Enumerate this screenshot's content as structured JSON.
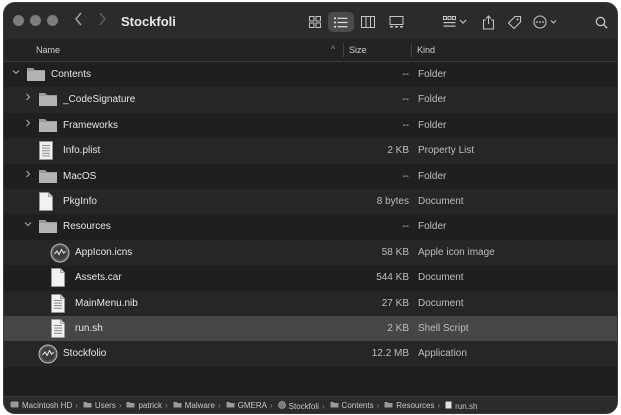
{
  "window": {
    "title": "Stockfoli"
  },
  "toolbar": {
    "back_icon": "chevron-left-icon",
    "forward_icon": "chevron-right-icon",
    "views": [
      "icon-view-icon",
      "list-view-icon",
      "column-view-icon",
      "gallery-view-icon"
    ],
    "group_icon": "group-icon",
    "share_icon": "share-icon",
    "tag_icon": "tag-icon",
    "more_icon": "more-icon",
    "search_icon": "search-icon"
  },
  "columns": {
    "name": "Name",
    "size": "Size",
    "kind": "Kind"
  },
  "rows": [
    {
      "name": "Contents",
      "size": "--",
      "kind": "Folder",
      "type": "folder",
      "disclosure": "open",
      "indent": 0
    },
    {
      "name": "_CodeSignature",
      "size": "--",
      "kind": "Folder",
      "type": "folder",
      "disclosure": "closed",
      "indent": 1
    },
    {
      "name": "Frameworks",
      "size": "--",
      "kind": "Folder",
      "type": "folder",
      "disclosure": "closed",
      "indent": 1
    },
    {
      "name": "Info.plist",
      "size": "2 KB",
      "kind": "Property List",
      "type": "plist",
      "disclosure": "",
      "indent": 1
    },
    {
      "name": "MacOS",
      "size": "--",
      "kind": "Folder",
      "type": "folder",
      "disclosure": "closed",
      "indent": 1
    },
    {
      "name": "PkgInfo",
      "size": "8 bytes",
      "kind": "Document",
      "type": "doc",
      "disclosure": "",
      "indent": 1
    },
    {
      "name": "Resources",
      "size": "--",
      "kind": "Folder",
      "type": "folder",
      "disclosure": "open",
      "indent": 1
    },
    {
      "name": "AppIcon.icns",
      "size": "58 KB",
      "kind": "Apple icon image",
      "type": "app",
      "disclosure": "",
      "indent": 2
    },
    {
      "name": "Assets.car",
      "size": "544 KB",
      "kind": "Document",
      "type": "doc",
      "disclosure": "",
      "indent": 2
    },
    {
      "name": "MainMenu.nib",
      "size": "27 KB",
      "kind": "Document",
      "type": "doclines",
      "disclosure": "",
      "indent": 2
    },
    {
      "name": "run.sh",
      "size": "2 KB",
      "kind": "Shell Script",
      "type": "doclines",
      "disclosure": "",
      "indent": 2,
      "selected": true
    },
    {
      "name": "Stockfolio",
      "size": "12.2 MB",
      "kind": "Application",
      "type": "app",
      "disclosure": "",
      "indent": 1
    }
  ],
  "pathbar": [
    {
      "label": "Macintosh HD",
      "icon": "disk-icon"
    },
    {
      "label": "Users",
      "icon": "folder-icon"
    },
    {
      "label": "patrick",
      "icon": "folder-icon"
    },
    {
      "label": "Malware",
      "icon": "folder-icon"
    },
    {
      "label": "GMERA",
      "icon": "folder-icon"
    },
    {
      "label": "Stockfoli",
      "icon": "app-icon"
    },
    {
      "label": "Contents",
      "icon": "folder-icon"
    },
    {
      "label": "Resources",
      "icon": "folder-icon"
    },
    {
      "label": "run.sh",
      "icon": "document-icon"
    }
  ]
}
